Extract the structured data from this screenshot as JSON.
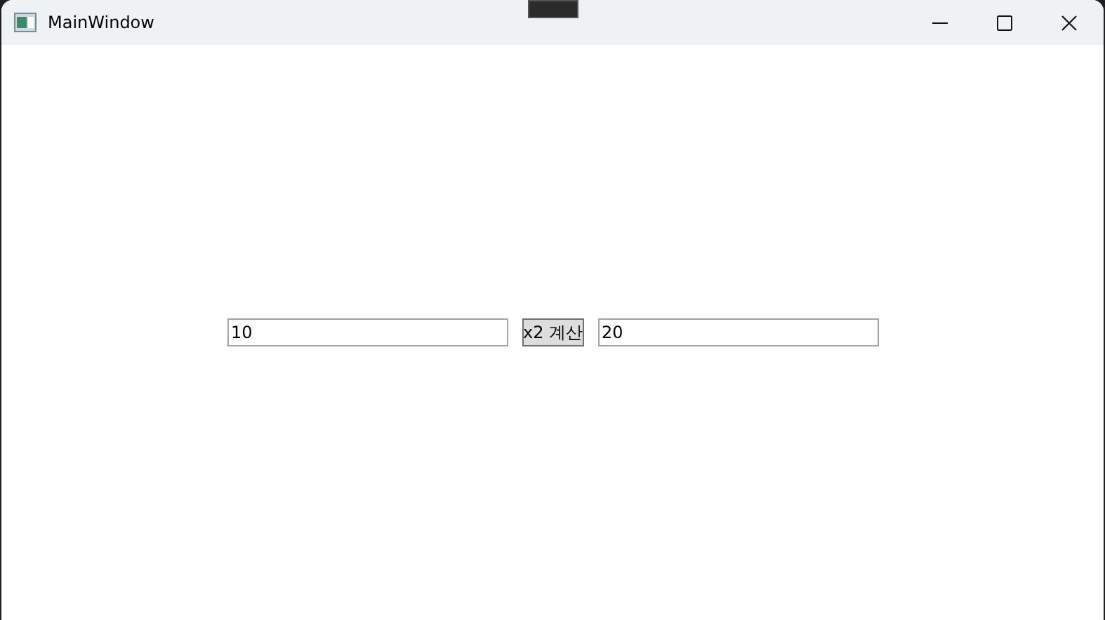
{
  "window": {
    "title": "MainWindow"
  },
  "form": {
    "input": {
      "value": "10"
    },
    "button": {
      "label": "x2 계산"
    },
    "output": {
      "value": "20"
    }
  }
}
